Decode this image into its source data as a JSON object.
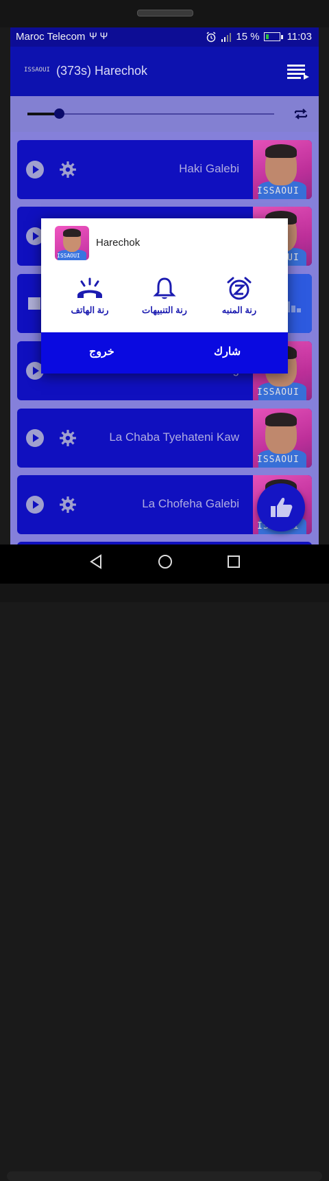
{
  "status_bar": {
    "carrier": "Maroc Telecom",
    "usb_icons": "Ψ Ψ",
    "battery_percent": "15 %",
    "time": "11:03"
  },
  "app_bar": {
    "logo_text": "ISSAOUI",
    "title": "(373s) Harechok"
  },
  "player": {
    "progress": 0.13
  },
  "songs": [
    {
      "title": "Haki Galebi",
      "watermark": "ISSAOUI",
      "state": "play"
    },
    {
      "title": "",
      "watermark": "ISSAOUI",
      "state": "play"
    },
    {
      "title": "",
      "watermark": "",
      "state": "stop"
    },
    {
      "title": "Ktabetell Meg",
      "watermark": "ISSAOUI",
      "state": "play"
    },
    {
      "title": "La Chaba Tyehateni Kaw",
      "watermark": "ISSAOUI",
      "state": "play"
    },
    {
      "title": "La Chofeha Galebi",
      "watermark": "ISSAOUI",
      "state": "play"
    }
  ],
  "dialog": {
    "title": "Harechok",
    "thumb_watermark": "ISSAOUI",
    "options": {
      "phone_ringtone": "رنة الهاتف",
      "notification_ringtone": "رنة التنبيهات",
      "alarm_ringtone": "رنة المنبه"
    },
    "exit_label": "خروج",
    "share_label": "شارك"
  },
  "colors": {
    "primary": "#0d12b6",
    "dialog_footer": "#0a0ae0",
    "list_bg": "#8c86e3"
  }
}
